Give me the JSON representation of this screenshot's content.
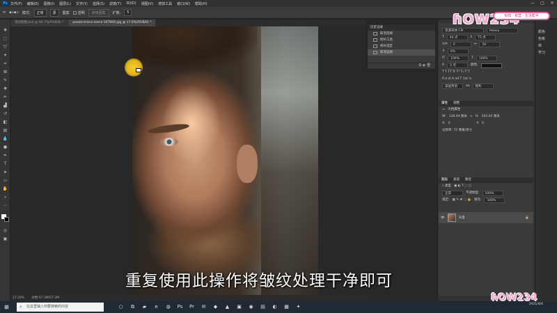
{
  "menubar": {
    "app_logo": "Ps",
    "items": [
      "文件(F)",
      "编辑(E)",
      "图像(I)",
      "图层(L)",
      "文字(Y)",
      "选择(S)",
      "滤镜(T)",
      "3D(D)",
      "视图(V)",
      "增效工具",
      "窗口(W)",
      "帮助(H)"
    ],
    "window_controls": [
      "—",
      "▢",
      "✕"
    ]
  },
  "options": {
    "mode_label": "模式:",
    "mode_value": "正常",
    "source_label": "源",
    "pattern_label": "图案",
    "transparent_label": "透明",
    "use_pattern_label": "使用图案",
    "spread_label": "扩散:",
    "spread_value": "5"
  },
  "tabs": [
    {
      "label": "诗词刮图.psd @ 66.7%(RGB/8) *",
      "active": false
    },
    {
      "label": "pexels-travis-seera-167669.jpg @ 17.6%(RGB/8) *",
      "active": true
    }
  ],
  "subtitle": "重复使用此操作将皱纹处理干净即可",
  "history": {
    "title": "历史记录",
    "rows": [
      "取消选择",
      "修补工具",
      "修补选区",
      "取消选择"
    ],
    "selected_index": 3
  },
  "character": {
    "font": "思源宋体 CN",
    "style": "Heavy",
    "size": "40 点",
    "leading": "75 点",
    "tracking_label": "V/A",
    "tracking": "0",
    "kerning": "50",
    "scale_pct": "0%",
    "vscale": "100%",
    "hscale": "100%",
    "baseline": "0 点",
    "color_label": "颜色:",
    "language": "美国英语",
    "antialias": "锐利"
  },
  "properties": {
    "tabs": [
      "属性",
      "调整"
    ],
    "doc_label": "文档属性",
    "w_label": "W:",
    "w_value": "128.44 厘米",
    "h_label": "H:",
    "h_value": "193.04 厘米",
    "x_label": "X:",
    "x_value": "0",
    "y_label": "Y:",
    "y_value": "0",
    "resolution": "分辨率: 72 像素/英寸"
  },
  "layers": {
    "tabs": [
      "图层",
      "通道",
      "路径"
    ],
    "blend": "正常",
    "opacity_label": "不透明度:",
    "opacity": "100%",
    "fill_label": "填充:",
    "fill": "100%",
    "lock_label": "锁定:",
    "layer_name": "背景"
  },
  "farright": [
    "颜色",
    "色板",
    "库",
    "学习"
  ],
  "logo": {
    "text": "ɦOW234",
    "pill": "有知 · 有营 · 生活帮手"
  },
  "status": {
    "zoom": "17.59%",
    "doc": "文档:57.3M/57.3M"
  },
  "taskbar": {
    "search_placeholder": "在这里输入你要搜索的内容",
    "time": "2021/4/6"
  }
}
